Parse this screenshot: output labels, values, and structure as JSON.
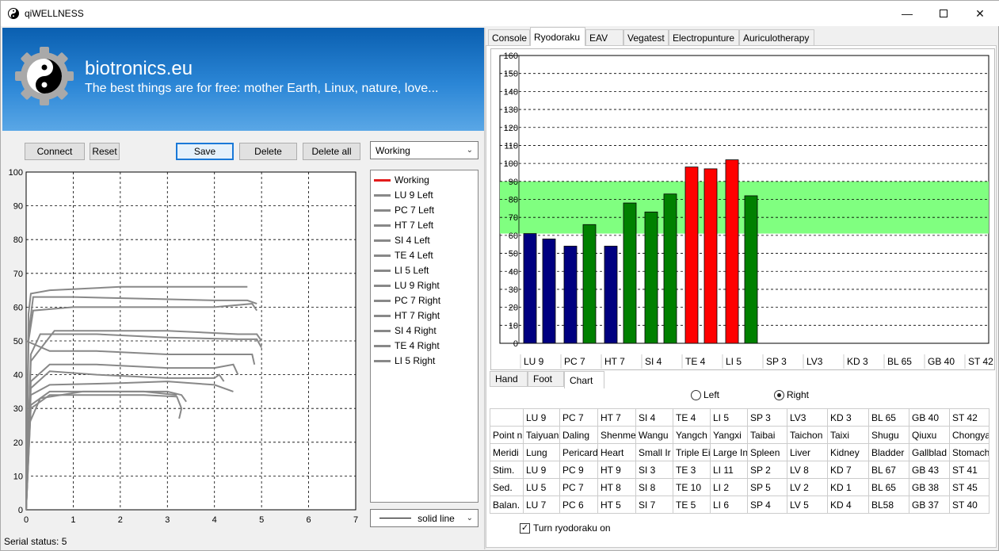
{
  "window": {
    "title": "qiWELLNESS",
    "controls": [
      "minimize",
      "maximize",
      "close"
    ]
  },
  "banner": {
    "title": "biotronics.eu",
    "subtitle": "The best things are for free: mother Earth, Linux, nature, love...",
    "logo_icon": "yin-yang-gear-icon"
  },
  "toolbar": {
    "connect_label": "Connect",
    "reset_label": "Reset",
    "save_label": "Save",
    "delete_label": "Delete",
    "delete_all_label": "Delete all",
    "series_select": "Working"
  },
  "legend": {
    "items": [
      {
        "label": "Working",
        "color": "#e31b1b"
      },
      {
        "label": "LU 9 Left",
        "color": "#888888"
      },
      {
        "label": "PC 7 Left",
        "color": "#888888"
      },
      {
        "label": "HT 7 Left",
        "color": "#888888"
      },
      {
        "label": "SI 4 Left",
        "color": "#888888"
      },
      {
        "label": "TE 4 Left",
        "color": "#888888"
      },
      {
        "label": "LI 5 Left",
        "color": "#888888"
      },
      {
        "label": "LU 9 Right",
        "color": "#888888"
      },
      {
        "label": "PC 7 Right",
        "color": "#888888"
      },
      {
        "label": "HT 7 Right",
        "color": "#888888"
      },
      {
        "label": "SI 4 Right",
        "color": "#888888"
      },
      {
        "label": "TE 4 Right",
        "color": "#888888"
      },
      {
        "label": "LI 5 Right",
        "color": "#888888"
      }
    ],
    "line_style_select": "solid line"
  },
  "status": {
    "text": "Serial status: 5"
  },
  "tabs": {
    "items": [
      "Console",
      "Ryodoraku",
      "EAV",
      "Vegatest",
      "Electropunture",
      "Auriculotherapy"
    ],
    "active": "Ryodoraku"
  },
  "subtabs": {
    "items": [
      "Hand",
      "Foot",
      "Chart"
    ],
    "active": "Chart"
  },
  "side_select": {
    "left_label": "Left",
    "right_label": "Right",
    "selected": "Right"
  },
  "point_table": {
    "header": [
      "",
      "LU 9",
      "PC 7",
      "HT 7",
      "SI 4",
      "TE 4",
      "LI 5",
      "SP 3",
      "LV3",
      "KD 3",
      "BL 65",
      "GB 40",
      "ST 42"
    ],
    "rows": [
      [
        "Point n",
        "Taiyuan",
        "Daling",
        "Shenme",
        "Wangu",
        "Yangch",
        "Yangxi",
        "Taibai",
        "Taichon",
        "Taixi",
        "Shugu",
        "Qiuxu",
        "Chongya"
      ],
      [
        "Meridi",
        "Lung",
        "Pericard",
        "Heart",
        "Small Ir",
        "Triple Ei",
        "Large In",
        "Spleen",
        "Liver",
        "Kidney",
        "Bladder",
        "Gallblad",
        "Stomach"
      ],
      [
        "Stim.",
        "LU 9",
        "PC 9",
        "HT 9",
        "SI 3",
        "TE 3",
        "LI 11",
        "SP 2",
        "LV 8",
        "KD 7",
        "BL 67",
        "GB 43",
        "ST 41"
      ],
      [
        "Sed.",
        "LU 5",
        "PC 7",
        "HT 8",
        "SI 8",
        "TE 10",
        "LI 2",
        "SP 5",
        "LV 2",
        "KD 1",
        "BL 65",
        "GB 38",
        "ST 45"
      ],
      [
        "Balan.",
        "LU 7",
        "PC 6",
        "HT 5",
        "SI 7",
        "TE 5",
        "LI 6",
        "SP 4",
        "LV 5",
        "KD 4",
        "BL58",
        "GB 37",
        "ST 40"
      ]
    ]
  },
  "ryodoraku_toggle": {
    "label": "Turn ryodoraku on",
    "checked": true
  },
  "chart_data": [
    {
      "type": "line",
      "x_ticks": [
        "0",
        "1",
        "2",
        "3",
        "4",
        "5",
        "6",
        "7"
      ],
      "y_ticks": [
        "0",
        "10",
        "20",
        "30",
        "40",
        "50",
        "60",
        "70",
        "80",
        "90",
        "100"
      ],
      "xlim": [
        0,
        7
      ],
      "ylim": [
        0,
        100
      ],
      "grid": true,
      "series": [
        {
          "name": "LU 9 Left",
          "color": "#888888",
          "points": [
            [
              0,
              0
            ],
            [
              0.05,
              58
            ],
            [
              0.1,
              64
            ],
            [
              0.5,
              65
            ],
            [
              2,
              66
            ],
            [
              3,
              66
            ],
            [
              4.5,
              66
            ],
            [
              4.7,
              66
            ]
          ]
        },
        {
          "name": "PC 7 Left",
          "color": "#888888",
          "points": [
            [
              0,
              0
            ],
            [
              0.05,
              52
            ],
            [
              0.15,
              63
            ],
            [
              1,
              63
            ],
            [
              2.5,
              62.5
            ],
            [
              4,
              62
            ],
            [
              4.7,
              62
            ],
            [
              4.9,
              61
            ]
          ]
        },
        {
          "name": "HT 7 Left",
          "color": "#888888",
          "points": [
            [
              0,
              0
            ],
            [
              0.05,
              50
            ],
            [
              0.15,
              59
            ],
            [
              1,
              60
            ],
            [
              2.5,
              60
            ],
            [
              4,
              60
            ],
            [
              4.8,
              61
            ],
            [
              4.9,
              59
            ]
          ]
        },
        {
          "name": "SI 4 Left",
          "color": "#888888",
          "points": [
            [
              0,
              0
            ],
            [
              0.1,
              44
            ],
            [
              0.6,
              53
            ],
            [
              1.5,
              53
            ],
            [
              3,
              53
            ],
            [
              4.5,
              52
            ],
            [
              4.9,
              52
            ],
            [
              5,
              50
            ]
          ]
        },
        {
          "name": "TE 4 Left",
          "color": "#888888",
          "points": [
            [
              0,
              0
            ],
            [
              0.1,
              46
            ],
            [
              0.3,
              52
            ],
            [
              1.5,
              52
            ],
            [
              3,
              51
            ],
            [
              4.5,
              50.5
            ],
            [
              4.9,
              50.5
            ],
            [
              5,
              48
            ]
          ]
        },
        {
          "name": "LI 5 Left",
          "color": "#888888",
          "points": [
            [
              0,
              0
            ],
            [
              0,
              50
            ],
            [
              0.5,
              47
            ],
            [
              1.5,
              47
            ],
            [
              3,
              46
            ],
            [
              4.5,
              46
            ],
            [
              4.8,
              46
            ],
            [
              4.85,
              43
            ]
          ]
        },
        {
          "name": "LU 9 Right",
          "color": "#888888",
          "points": [
            [
              0,
              0
            ],
            [
              0.1,
              38
            ],
            [
              0.5,
              43
            ],
            [
              1.5,
              43
            ],
            [
              3,
              42
            ],
            [
              4,
              42
            ],
            [
              4.4,
              43
            ],
            [
              4.5,
              40
            ]
          ]
        },
        {
          "name": "PC 7 Right",
          "color": "#888888",
          "points": [
            [
              0,
              0
            ],
            [
              0.1,
              36
            ],
            [
              0.5,
              41
            ],
            [
              1.5,
              40
            ],
            [
              3,
              39
            ],
            [
              4,
              39
            ],
            [
              4.1,
              40
            ],
            [
              4.2,
              38
            ]
          ]
        },
        {
          "name": "HT 7 Right",
          "color": "#888888",
          "points": [
            [
              0,
              0
            ],
            [
              0.1,
              34
            ],
            [
              0.5,
              37
            ],
            [
              2,
              37.5
            ],
            [
              3,
              38
            ],
            [
              4,
              37
            ],
            [
              4.4,
              35
            ]
          ]
        },
        {
          "name": "SI 4 Right",
          "color": "#888888",
          "points": [
            [
              0,
              0
            ],
            [
              0.1,
              31
            ],
            [
              0.5,
              35
            ],
            [
              1.5,
              35
            ],
            [
              2.5,
              35
            ],
            [
              3,
              35
            ],
            [
              3.3,
              34
            ],
            [
              3.4,
              32
            ]
          ]
        },
        {
          "name": "TE 4 Right",
          "color": "#888888",
          "points": [
            [
              0,
              0
            ],
            [
              0.1,
              30
            ],
            [
              0.5,
              34
            ],
            [
              1.5,
              34
            ],
            [
              2.5,
              34
            ],
            [
              3.2,
              33.5
            ],
            [
              3.3,
              30
            ],
            [
              3.25,
              27
            ]
          ]
        },
        {
          "name": "LI 5 Right",
          "color": "#888888",
          "points": [
            [
              0,
              0
            ],
            [
              0.05,
              25
            ],
            [
              0.3,
              33
            ],
            [
              1.2,
              35
            ],
            [
              2.5,
              35
            ],
            [
              3.2,
              34
            ]
          ]
        }
      ]
    },
    {
      "type": "bar",
      "categories": [
        "LU 9",
        "PC 7",
        "HT 7",
        "SI 4",
        "TE 4",
        "LI 5",
        "SP 3",
        "LV3",
        "KD 3",
        "BL 65",
        "GB 40",
        "ST 42"
      ],
      "ylim": [
        0,
        160
      ],
      "y_ticks": [
        0,
        10,
        20,
        30,
        40,
        50,
        60,
        70,
        80,
        90,
        100,
        110,
        120,
        130,
        140,
        150,
        160
      ],
      "grid": true,
      "normal_band": [
        61,
        90
      ],
      "band_color": "#80ff80",
      "series": [
        {
          "name": "Left",
          "values": [
            61,
            54,
            54,
            73,
            98,
            102,
            null,
            null,
            null,
            null,
            null,
            null
          ],
          "colors": [
            "#000080",
            "#000080",
            "#000080",
            "#008000",
            "#ff0000",
            "#ff0000"
          ]
        },
        {
          "name": "Right",
          "values": [
            58,
            66,
            78,
            83,
            97,
            82,
            null,
            null,
            null,
            null,
            null,
            null
          ],
          "colors": [
            "#000080",
            "#008000",
            "#008000",
            "#008000",
            "#ff0000",
            "#008000"
          ]
        }
      ]
    }
  ]
}
